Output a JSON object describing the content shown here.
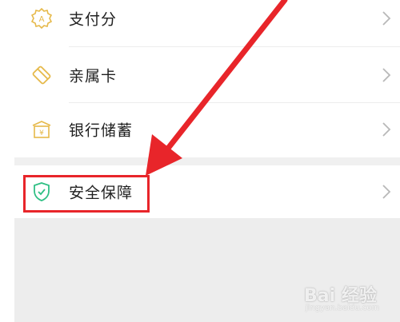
{
  "menu": {
    "items": [
      {
        "label": "支付分",
        "icon": "payscore-icon"
      },
      {
        "label": "亲属卡",
        "icon": "family-card-icon"
      },
      {
        "label": "银行储蓄",
        "icon": "bank-savings-icon"
      },
      {
        "label": "安全保障",
        "icon": "security-shield-icon"
      }
    ]
  },
  "annotation": {
    "highlight_color": "#e8252a",
    "arrow_color": "#e8252a",
    "highlighted_item": "安全保障"
  },
  "watermark": {
    "brand": "Bai  经验",
    "site": "jingyan.baidu.com"
  },
  "colors": {
    "icon_yellow": "#e6b94a",
    "icon_green": "#2fbf84",
    "gray_background": "#ededed"
  }
}
